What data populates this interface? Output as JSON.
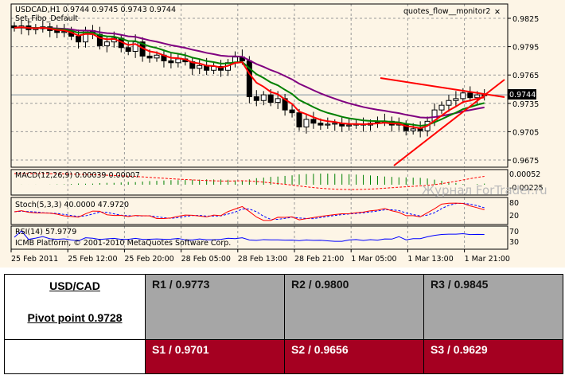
{
  "chart": {
    "header": "USDCAD,H1  0.9744 0.9745 0.9743 0.9744",
    "template": "Set_Fibo_Default",
    "expert": "quotes_flow__monitor2",
    "close_icon": "close-x-icon",
    "price_labels": [
      "0.9825",
      "0.9795",
      "0.9765",
      "0.9735",
      "0.9705",
      "0.9675"
    ],
    "current_price": "0.9744",
    "time_labels": [
      "25 Feb 2011",
      "25 Feb 12:00",
      "25 Feb 20:00",
      "28 Feb 05:00",
      "28 Feb 13:00",
      "28 Feb 21:00",
      "1 Mar 05:00",
      "1 Mar 13:00",
      "1 Mar 21:00"
    ],
    "macd_label": "MACD(12,26,9) 0.00039 0.00007",
    "macd_axis": [
      "0.00052",
      "-0.00225"
    ],
    "stoch_label": "Stoch(5,3,3) 40.0000 47.9720",
    "stoch_axis": [
      "80",
      "20"
    ],
    "rsi_label": "RSI(14) 57.9779",
    "rsi_axis": [
      "70",
      "30"
    ],
    "copyright": "ICMB Platform, © 2001-2010 MetaQuotes Software Corp.",
    "watermark": "Журнал ForTrader.ru",
    "colors": {
      "bg": "#fdf5e6",
      "ma_fast": "#ff0000",
      "ma_mid": "#008000",
      "ma_slow": "#800080",
      "trend": "#ff0000"
    },
    "closes": [
      0.9815,
      0.9817,
      0.9813,
      0.9814,
      0.9816,
      0.9812,
      0.981,
      0.9811,
      0.9806,
      0.98,
      0.9812,
      0.9808,
      0.9796,
      0.98,
      0.9804,
      0.9794,
      0.979,
      0.98,
      0.9785,
      0.9783,
      0.9786,
      0.978,
      0.9778,
      0.9782,
      0.9779,
      0.9772,
      0.9775,
      0.977,
      0.9774,
      0.977,
      0.9778,
      0.9784,
      0.978,
      0.9742,
      0.9738,
      0.9744,
      0.9736,
      0.974,
      0.9728,
      0.9725,
      0.971,
      0.9718,
      0.9714,
      0.9712,
      0.9713,
      0.9714,
      0.9711,
      0.9712,
      0.9713,
      0.9712,
      0.9714,
      0.9715,
      0.9716,
      0.9712,
      0.9713,
      0.9706,
      0.9708,
      0.9706,
      0.9716,
      0.9728,
      0.9733,
      0.9738,
      0.974,
      0.9746,
      0.9741,
      0.9744,
      0.9744
    ]
  },
  "pivot": {
    "pair": "USD/CAD",
    "pivot": "Pivot point 0.9728",
    "r": [
      "R1 / 0.9773",
      "R2 / 0.9800",
      "R3 / 0.9845"
    ],
    "s": [
      "S1 / 0.9701",
      "S2 / 0.9656",
      "S3 / 0.9629"
    ]
  }
}
